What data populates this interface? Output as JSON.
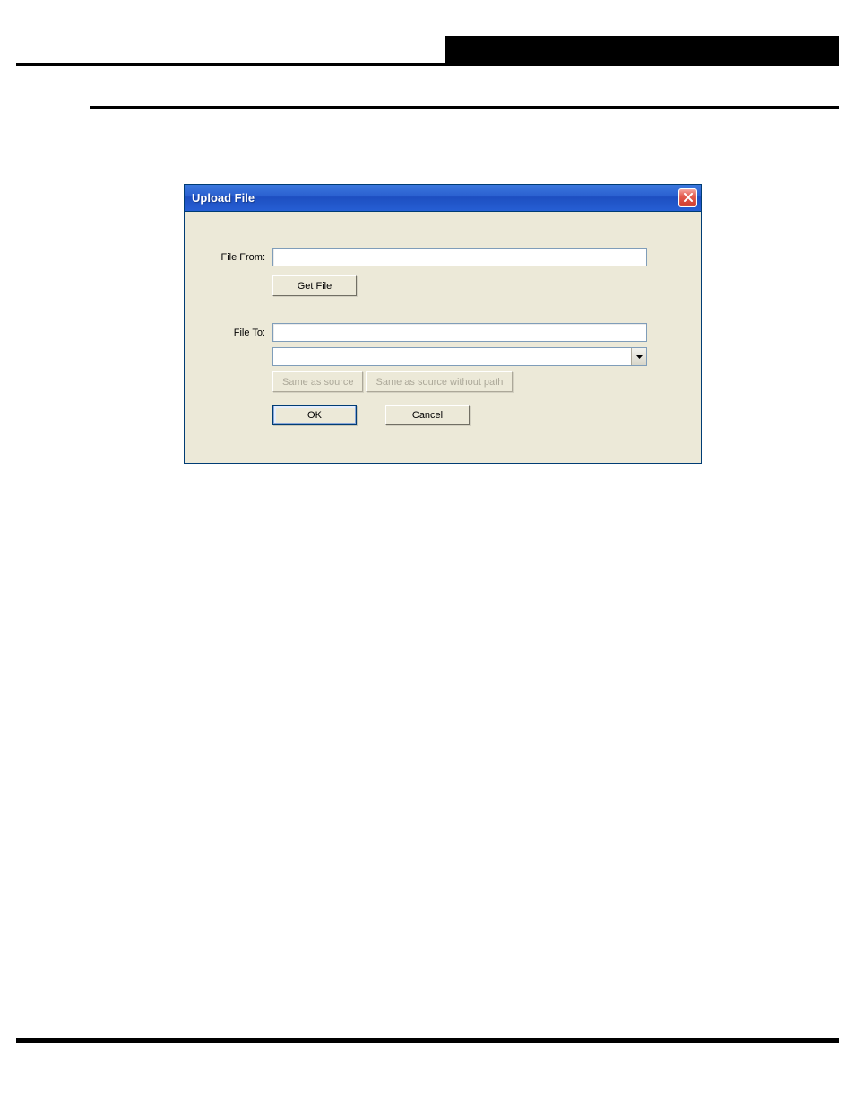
{
  "dialog": {
    "title": "Upload File",
    "labels": {
      "file_from": "File From:",
      "file_to": "File To:"
    },
    "inputs": {
      "file_from_value": "",
      "file_to_value": "",
      "combo_value": ""
    },
    "buttons": {
      "get_file": "Get File",
      "same_as_source": "Same as source",
      "same_as_source_no_path": "Same as source without path",
      "ok": "OK",
      "cancel": "Cancel"
    }
  }
}
